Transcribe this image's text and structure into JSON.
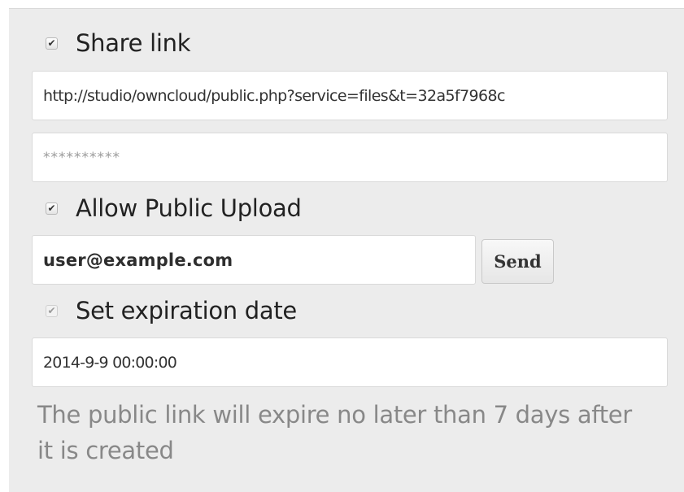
{
  "share": {
    "share_link_label": "Share link",
    "share_link_checked": true,
    "link_url": "http://studio/owncloud/public.php?service=files&t=32a5f7968c",
    "password_value": "**********",
    "allow_upload_label": "Allow Public Upload",
    "allow_upload_checked": true,
    "email_value": "user@example.com",
    "send_label": "Send",
    "expiration_label": "Set expiration date",
    "expiration_checked": true,
    "expiration_disabled": true,
    "expiration_value": "2014-9-9 00:00:00",
    "expiration_note": "The public link will expire no later than 7 days after it is created"
  },
  "check_mark": "✔",
  "icons": {
    "checkbox": "checkbox-icon"
  },
  "colors": {
    "panel_bg": "#ececec",
    "field_bg": "#ffffff",
    "note_text": "#888888"
  }
}
